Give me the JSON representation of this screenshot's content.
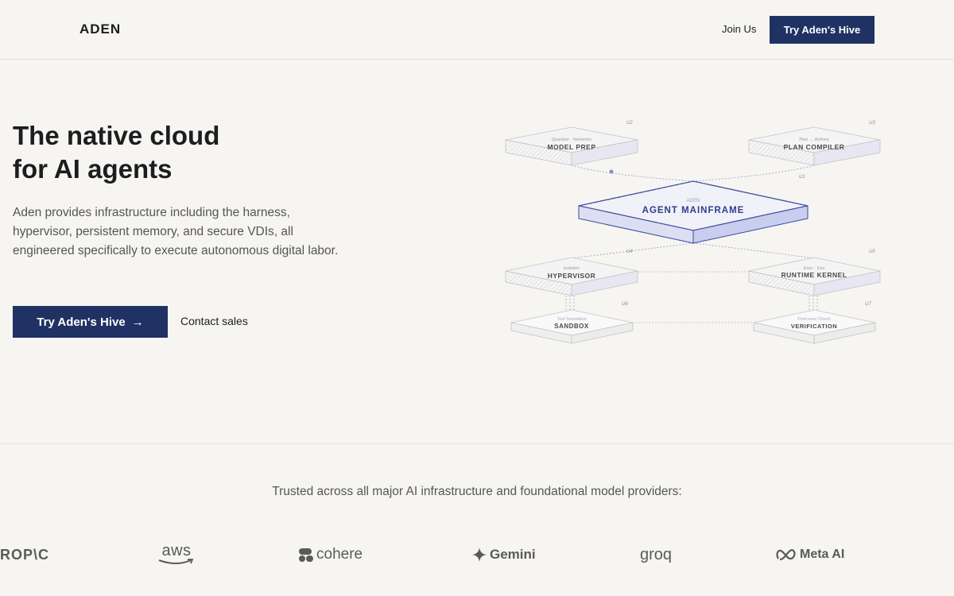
{
  "nav": {
    "brand": "ADEN",
    "join_label": "Join Us",
    "cta_label": "Try Aden's Hive"
  },
  "hero": {
    "title_line1": "The native cloud",
    "title_line2": "for AI agents",
    "description": "Aden provides infrastructure including the harness, hypervisor, persistent memory, and secure VDIs, all engineered specifically to execute autonomous digital labor.",
    "cta_label": "Try Aden's Hive",
    "cta_arrow": "→",
    "contact_label": "Contact sales"
  },
  "diagram": {
    "center": {
      "tag": "ADEN",
      "label": "AGENT MAINFRAME",
      "id": "U1"
    },
    "nodes": [
      {
        "id": "U2",
        "tag": "Quantize · Numerics",
        "label": "MODEL PREP"
      },
      {
        "id": "U3",
        "tag": "Plan → Actions",
        "label": "PLAN COMPILER"
      },
      {
        "id": "U4",
        "tag": "Isolation",
        "label": "HYPERVISOR"
      },
      {
        "id": "U5",
        "tag": "Exec · Env",
        "label": "RUNTIME KERNEL"
      },
      {
        "id": "U6",
        "tag": "Tool Simulation",
        "label": "SANDBOX"
      },
      {
        "id": "U7",
        "tag": "Post-exec Check",
        "label": "VERIFICATION"
      }
    ]
  },
  "trusted": {
    "text": "Trusted across all major AI infrastructure and foundational model providers:",
    "logos": [
      {
        "name": "anthropic",
        "text": "ROP\\C"
      },
      {
        "name": "aws",
        "text": "aws"
      },
      {
        "name": "cohere",
        "text": "cohere"
      },
      {
        "name": "gemini",
        "text": "Gemini"
      },
      {
        "name": "groq",
        "text": "groq"
      },
      {
        "name": "meta-ai",
        "text": "Meta AI"
      }
    ]
  },
  "colors": {
    "accent": "#1f3263",
    "background": "#f6f5f2",
    "mainframe_fill": "#e8eaf8",
    "mainframe_stroke": "#3a4a9a"
  }
}
